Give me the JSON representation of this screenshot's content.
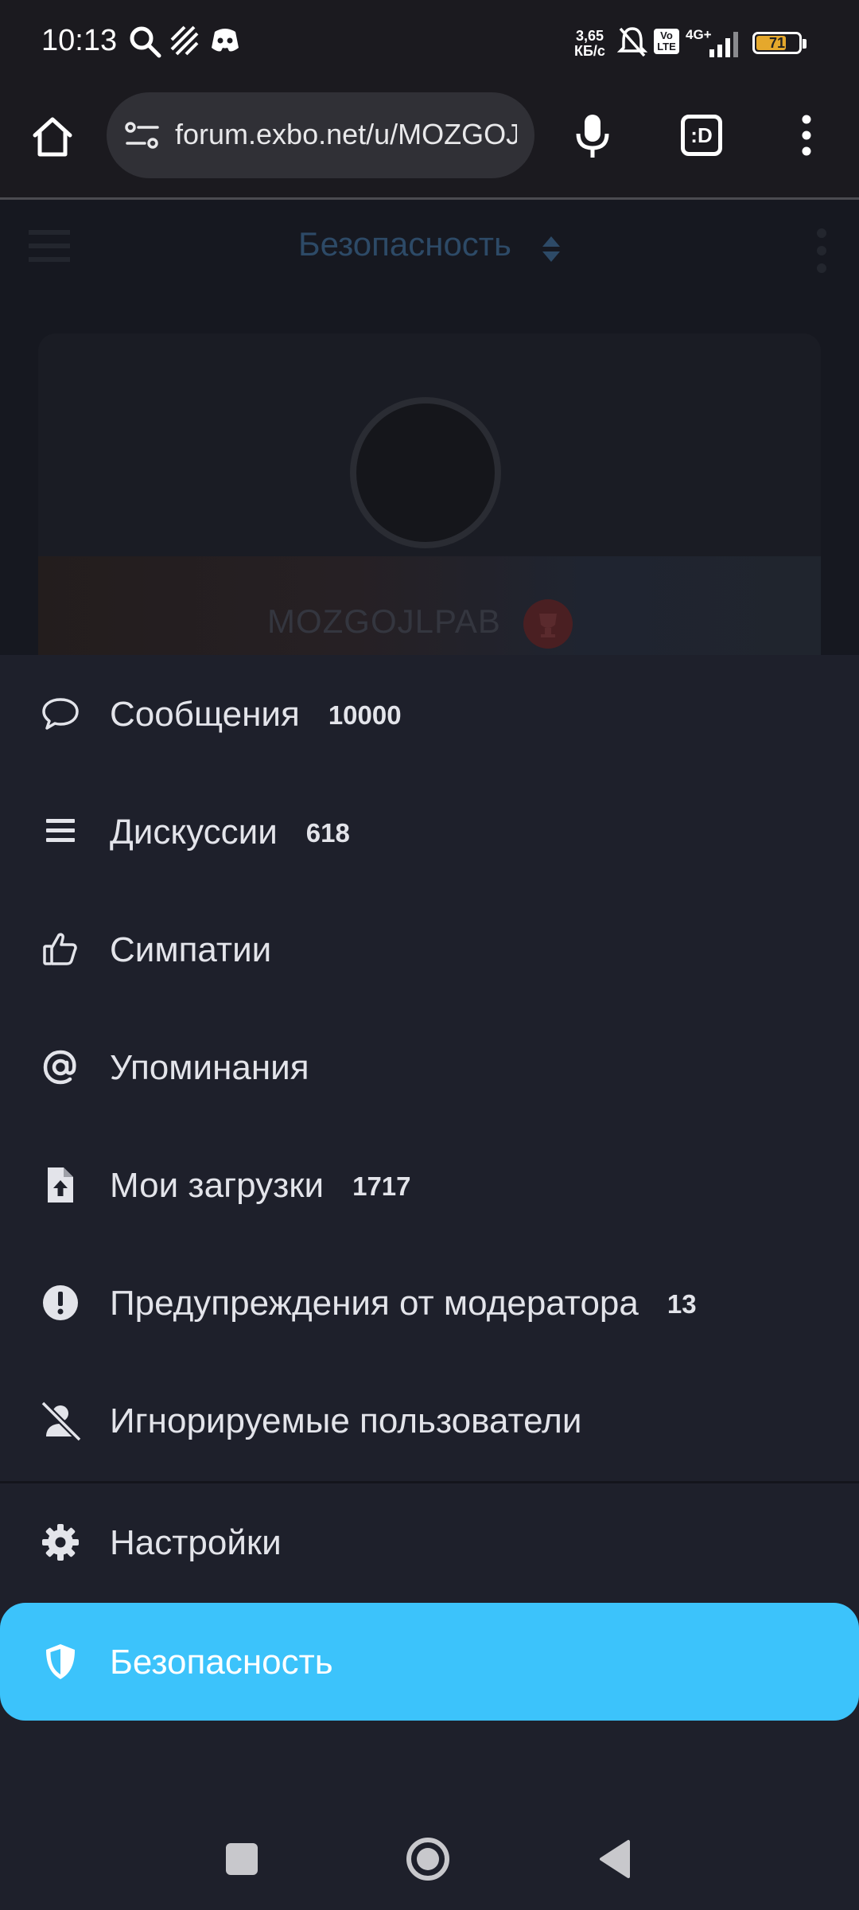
{
  "status_bar": {
    "time": "10:13",
    "net_speed_value": "3,65",
    "net_speed_unit": "КБ/с",
    "volte": "Vo LTE",
    "network": "4G+",
    "battery": "71",
    "battery_level": 0.71,
    "icons": [
      "search-icon",
      "stripes-icon",
      "discord-icon",
      "bell-muted-icon",
      "signal-icon",
      "battery-icon"
    ]
  },
  "browser": {
    "url": "forum.exbo.net/u/MOZGOJLPAB",
    "tab_label": ":D",
    "icons": [
      "home-icon",
      "site-settings-icon",
      "mic-icon",
      "tab-switcher-icon",
      "more-vertical-icon"
    ]
  },
  "page": {
    "title": "Безопасность",
    "username": "MOZGOJLPAB"
  },
  "drawer": {
    "items": [
      {
        "label": "Сообщения",
        "count": "10000",
        "icon": "comment-icon"
      },
      {
        "label": "Дискуссии",
        "count": "618",
        "icon": "list-icon"
      },
      {
        "label": "Симпатии",
        "count": "",
        "icon": "thumbs-up-icon"
      },
      {
        "label": "Упоминания",
        "count": "",
        "icon": "at-icon"
      },
      {
        "label": "Мои загрузки",
        "count": "1717",
        "icon": "file-upload-icon"
      },
      {
        "label": "Предупреждения от модератора",
        "count": "13",
        "icon": "exclamation-icon"
      },
      {
        "label": "Игнорируемые пользователи",
        "count": "",
        "icon": "user-slash-icon"
      },
      {
        "label": "Настройки",
        "count": "",
        "icon": "gear-icon"
      },
      {
        "label": "Безопасность",
        "count": "",
        "icon": "shield-icon"
      }
    ],
    "active_item": "Безопасность"
  },
  "colors": {
    "accent": "#3cc3fb",
    "drawer_bg": "#1e202b",
    "browser_bg": "#1b1a1f"
  },
  "nav_bar": {
    "icons": [
      "recents-square-icon",
      "home-circle-icon",
      "back-triangle-icon"
    ]
  }
}
